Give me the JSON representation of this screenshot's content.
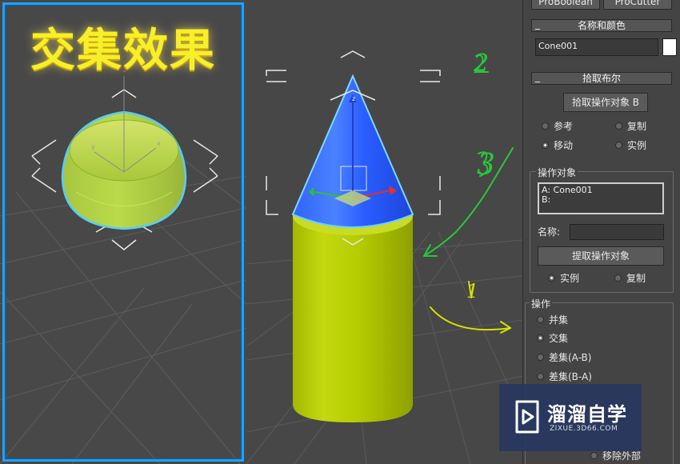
{
  "preview": {
    "title": "交集效果"
  },
  "annotations": {
    "num1": "1",
    "num2": "2",
    "num3": "3"
  },
  "panel": {
    "top_buttons": [
      "ProBoolean",
      "ProCutter"
    ],
    "name_color": {
      "header": "名称和颜色",
      "object_name": "Cone001",
      "swatch_color": "#ffffff"
    },
    "pick_boolean": {
      "header": "拾取布尔",
      "pick_button": "拾取操作对象 B",
      "options": [
        {
          "label": "参考",
          "checked": false
        },
        {
          "label": "复制",
          "checked": false
        },
        {
          "label": "移动",
          "checked": true
        },
        {
          "label": "实例",
          "checked": false
        }
      ]
    },
    "operands": {
      "title": "操作对象",
      "list": [
        "A: Cone001",
        "B:"
      ],
      "name_label": "名称:",
      "name_value": "",
      "extract_button": "提取操作对象",
      "options": [
        {
          "label": "实例",
          "checked": true
        },
        {
          "label": "复制",
          "checked": false
        }
      ]
    },
    "operation": {
      "title": "操作",
      "options": [
        {
          "label": "并集",
          "checked": false
        },
        {
          "label": "交集",
          "checked": true
        },
        {
          "label": "差集(A-B)",
          "checked": false
        },
        {
          "label": "差集(B-A)",
          "checked": false
        }
      ],
      "cut_option": "移除外部"
    }
  },
  "watermark": {
    "brand": "溜溜自学",
    "url": "ZIXUE.3D66.COM"
  },
  "colors": {
    "selection_blue": "#1aa3ff",
    "cone_blue": "#1e66ff",
    "cylinder_yellow": "#b8d400",
    "annotation_green": "#28c83a",
    "annotation_yellow": "#d7e000"
  }
}
